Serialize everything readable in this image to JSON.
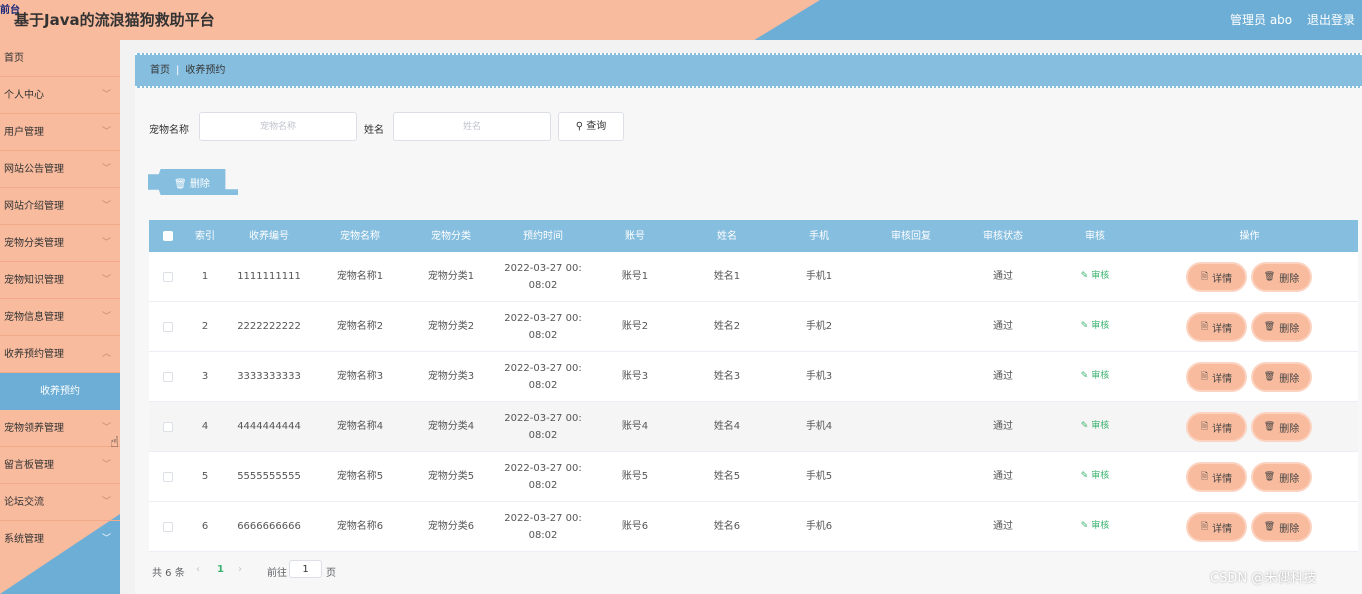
{
  "header": {
    "corner_badge": "前台",
    "title": "基于Java的流浪猫狗救助平台",
    "admin": "管理员 abo",
    "logout": "退出登录"
  },
  "sidebar": {
    "items": [
      {
        "label": "首页"
      },
      {
        "label": "个人中心"
      },
      {
        "label": "用户管理"
      },
      {
        "label": "网站公告管理"
      },
      {
        "label": "网站介绍管理"
      },
      {
        "label": "宠物分类管理"
      },
      {
        "label": "宠物知识管理"
      },
      {
        "label": "宠物信息管理"
      },
      {
        "label": "收养预约管理"
      },
      {
        "label": "收养预约"
      },
      {
        "label": "宠物领养管理"
      },
      {
        "label": "留言板管理"
      },
      {
        "label": "论坛交流"
      },
      {
        "label": "系统管理"
      }
    ]
  },
  "breadcrumb": {
    "home": "首页",
    "current": "收养预约"
  },
  "search": {
    "pet_name_label": "宠物名称",
    "pet_name_placeholder": "宠物名称",
    "name_label": "姓名",
    "name_placeholder": "姓名",
    "query_button": "查询"
  },
  "toolbar": {
    "delete_label": "删除"
  },
  "table": {
    "headers": [
      "索引",
      "收养编号",
      "宠物名称",
      "宠物分类",
      "预约时间",
      "账号",
      "姓名",
      "手机",
      "审核回复",
      "审核状态",
      "审核",
      "操作"
    ],
    "rows": [
      {
        "index": "1",
        "code": "1111111111",
        "pet": "宠物名称1",
        "category": "宠物分类1",
        "time1": "2022-03-27 00:",
        "time2": "08:02",
        "account": "账号1",
        "name": "姓名1",
        "phone": "手机1",
        "reply": "",
        "status": "通过"
      },
      {
        "index": "2",
        "code": "2222222222",
        "pet": "宠物名称2",
        "category": "宠物分类2",
        "time1": "2022-03-27 00:",
        "time2": "08:02",
        "account": "账号2",
        "name": "姓名2",
        "phone": "手机2",
        "reply": "",
        "status": "通过"
      },
      {
        "index": "3",
        "code": "3333333333",
        "pet": "宠物名称3",
        "category": "宠物分类3",
        "time1": "2022-03-27 00:",
        "time2": "08:02",
        "account": "账号3",
        "name": "姓名3",
        "phone": "手机3",
        "reply": "",
        "status": "通过"
      },
      {
        "index": "4",
        "code": "4444444444",
        "pet": "宠物名称4",
        "category": "宠物分类4",
        "time1": "2022-03-27 00:",
        "time2": "08:02",
        "account": "账号4",
        "name": "姓名4",
        "phone": "手机4",
        "reply": "",
        "status": "通过"
      },
      {
        "index": "5",
        "code": "5555555555",
        "pet": "宠物名称5",
        "category": "宠物分类5",
        "time1": "2022-03-27 00:",
        "time2": "08:02",
        "account": "账号5",
        "name": "姓名5",
        "phone": "手机5",
        "reply": "",
        "status": "通过"
      },
      {
        "index": "6",
        "code": "6666666666",
        "pet": "宠物名称6",
        "category": "宠物分类6",
        "time1": "2022-03-27 00:",
        "time2": "08:02",
        "account": "账号6",
        "name": "姓名6",
        "phone": "手机6",
        "reply": "",
        "status": "通过"
      }
    ],
    "audit_label": "审核",
    "detail_label": "详情",
    "row_delete_label": "删除"
  },
  "pagination": {
    "total": "共 6 条",
    "prev": "‹",
    "current_page": "1",
    "next": "›",
    "goto_label": "前往",
    "goto_value": "1",
    "page_suffix": "页"
  },
  "watermark": "CSDN @米偶科技",
  "colors": {
    "peach": "#f8bb9e",
    "blue": "#6caed6",
    "light_blue": "#86bedf",
    "green": "#3cb371"
  }
}
